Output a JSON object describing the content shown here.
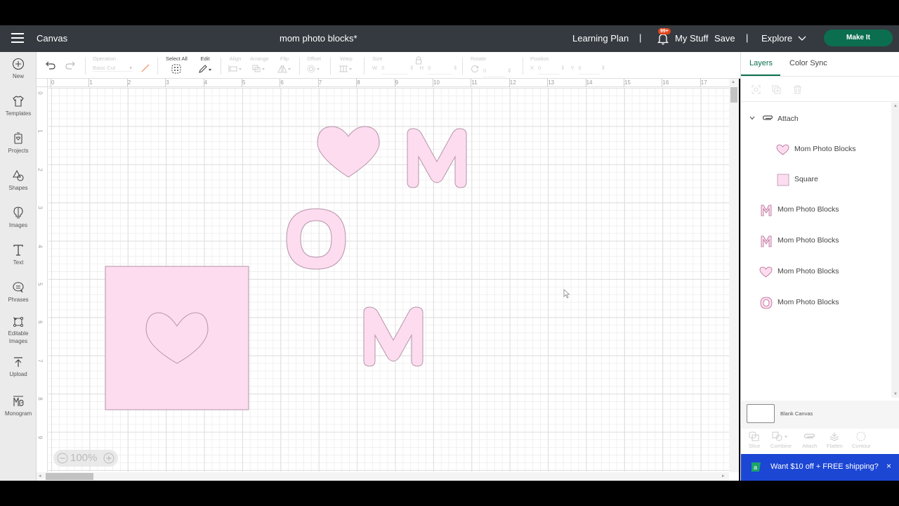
{
  "header": {
    "app_name": "Canvas",
    "doc_title": "mom photo blocks*",
    "learning_plan": "Learning Plan",
    "separator": "|",
    "notification_badge": "99+",
    "my_stuff": "My Stuff",
    "save": "Save",
    "explore": "Explore",
    "make_it": "Make It"
  },
  "sidebar": {
    "items": [
      {
        "label": "New",
        "icon": "plus-circle-icon"
      },
      {
        "label": "Templates",
        "icon": "tshirt-icon"
      },
      {
        "label": "Projects",
        "icon": "project-icon"
      },
      {
        "label": "Shapes",
        "icon": "shapes-icon"
      },
      {
        "label": "Images",
        "icon": "lightbulb-icon"
      },
      {
        "label": "Text",
        "icon": "text-icon"
      },
      {
        "label": "Phrases",
        "icon": "speech-bubble-icon"
      },
      {
        "label": "Editable Images",
        "icon": "editable-image-icon"
      },
      {
        "label": "Upload",
        "icon": "upload-icon"
      },
      {
        "label": "Monogram",
        "icon": "monogram-icon"
      }
    ]
  },
  "toolbar": {
    "operation_label": "Operation",
    "operation_value": "Basic Cut",
    "select_all": "Select All",
    "edit": "Edit",
    "align": "Align",
    "arrange": "Arrange",
    "flip": "Flip",
    "offset": "Offset",
    "warp": "Warp",
    "size": "Size",
    "w": "W",
    "h": "H",
    "w_value": "0",
    "h_value": "0",
    "rotate": "Rotate",
    "rotate_value": "0",
    "position": "Position",
    "x": "X",
    "y": "Y",
    "x_value": "0",
    "y_value": "0"
  },
  "canvas": {
    "ruler_top": [
      "0",
      "1",
      "2",
      "3",
      "4",
      "5",
      "6",
      "7",
      "8",
      "9",
      "10",
      "11",
      "12",
      "13",
      "14",
      "15",
      "16",
      "17"
    ],
    "ruler_left": [
      "0",
      "1",
      "2",
      "3",
      "4",
      "5",
      "6",
      "7",
      "8",
      "9"
    ],
    "zoom_level": "100%",
    "shape_fill": "#fddcf0",
    "shape_stroke": "#b595a8"
  },
  "panel": {
    "tabs": [
      "Layers",
      "Color Sync"
    ],
    "layers": [
      {
        "label": "Attach",
        "type": "group",
        "icon": "attach-icon"
      },
      {
        "label": "Mom Photo Blocks",
        "type": "child",
        "icon": "heart-icon"
      },
      {
        "label": "Square",
        "type": "child",
        "icon": "square-icon"
      },
      {
        "label": "Mom Photo Blocks",
        "type": "top",
        "icon": "letter-m-icon"
      },
      {
        "label": "Mom Photo Blocks",
        "type": "top",
        "icon": "letter-m-icon"
      },
      {
        "label": "Mom Photo Blocks",
        "type": "top",
        "icon": "heart-icon"
      },
      {
        "label": "Mom Photo Blocks",
        "type": "top",
        "icon": "letter-o-icon"
      }
    ],
    "blank_canvas": "Blank Canvas",
    "bottom_tools": [
      "Slice",
      "Combine",
      "Attach",
      "Flatten",
      "Contour"
    ],
    "promo": "Want $10 off + FREE shipping?"
  }
}
